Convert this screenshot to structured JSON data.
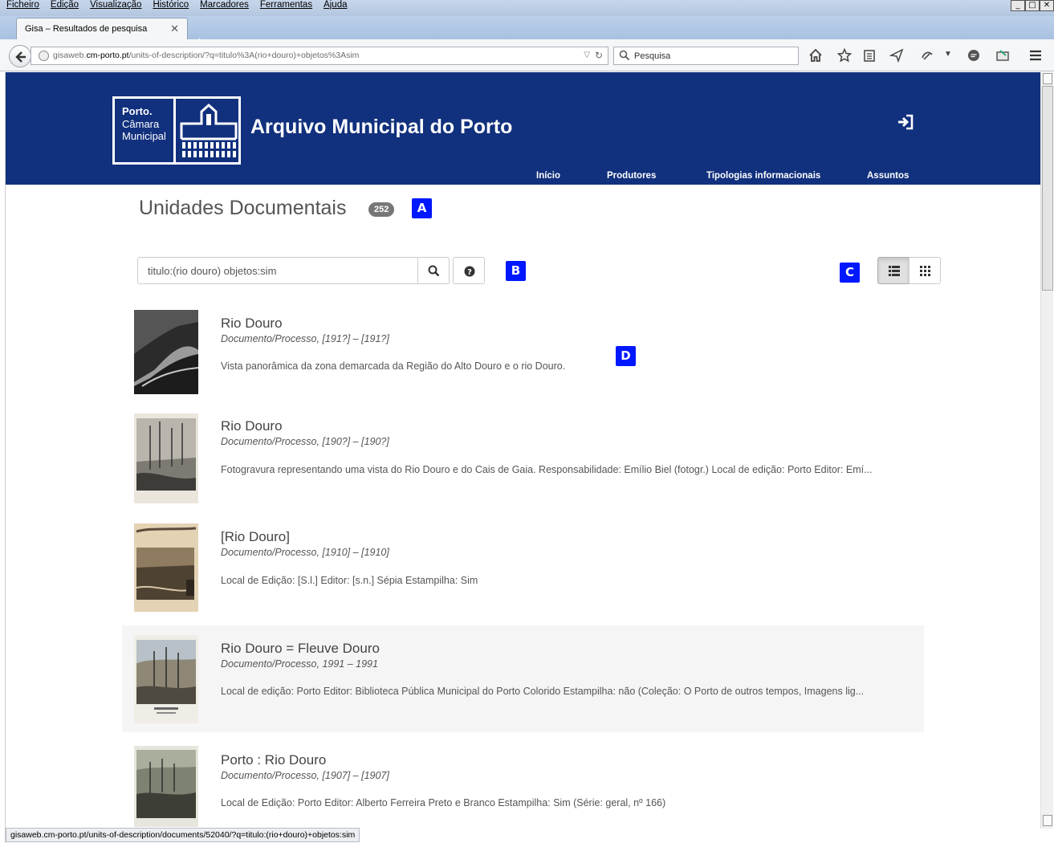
{
  "browser": {
    "menu": [
      "Ficheiro",
      "Edição",
      "Visualização",
      "Histórico",
      "Marcadores",
      "Ferramentas",
      "Ajuda"
    ],
    "tab_title": "Gisa – Resultados de pesquisa",
    "url_host": "gisaweb.",
    "url_domain": "cm-porto.pt",
    "url_path": "/units-of-description/?q=titulo%3A(rio+douro)+objetos%3Asim",
    "search_placeholder": "Pesquisa",
    "status_url": "gisaweb.cm-porto.pt/units-of-description/documents/52040/?q=titulo:(rio+douro)+objetos:sim"
  },
  "site": {
    "logo_line1": "Porto.",
    "logo_line2": "Câmara",
    "logo_line3": "Municipal",
    "title": "Arquivo Municipal do Porto",
    "nav": [
      "Início",
      "Produtores",
      "Tipologias informacionais",
      "Assuntos"
    ],
    "brand_color": "#11307d"
  },
  "page": {
    "title": "Unidades Documentais",
    "count": "252",
    "search_value": "titulo:(rio douro) objetos:sim",
    "annotations": [
      "A",
      "B",
      "C",
      "D"
    ]
  },
  "results": [
    {
      "title": "Rio Douro",
      "type": "Documento/Processo, [191?] – [191?]",
      "description": "Vista panorâmica da zona demarcada da Região do Alto Douro e o rio Douro."
    },
    {
      "title": "Rio Douro",
      "type": "Documento/Processo, [190?] – [190?]",
      "description": "Fotogravura representando uma vista do Rio Douro e do Cais de Gaia. Responsabilidade: Emílio Biel (fotogr.) Local de edição: Porto Editor: Emí..."
    },
    {
      "title": "[Rio Douro]",
      "type": "Documento/Processo, [1910] – [1910]",
      "description": "Local de Edição: [S.l.] Editor: [s.n.] Sépia Estampilha: Sim"
    },
    {
      "title": "Rio Douro = Fleuve Douro",
      "type": "Documento/Processo, 1991 – 1991",
      "description": "Local de edição: Porto Editor: Biblioteca Pública Municipal do Porto Colorido Estampilha: não (Coleção: O Porto de outros tempos, Imagens lig..."
    },
    {
      "title": "Porto : Rio Douro",
      "type": "Documento/Processo, [1907] – [1907]",
      "description": "Local de Edição: Porto Editor: Alberto Ferreira Preto e Branco Estampilha: Sim (Série: geral, nº 166)"
    }
  ]
}
